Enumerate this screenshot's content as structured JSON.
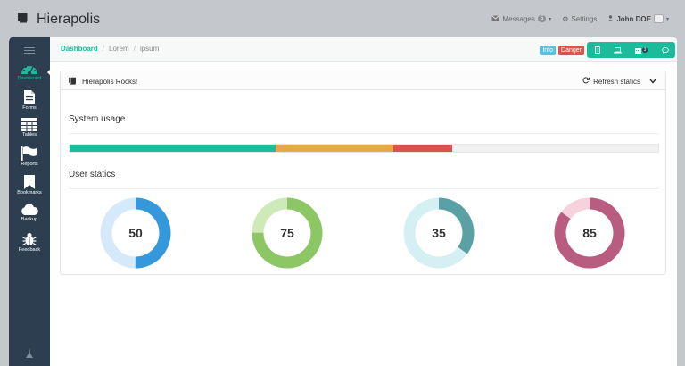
{
  "app": {
    "title": "Hierapolis"
  },
  "topnav": {
    "messages_label": "Messages",
    "messages_count": "5",
    "settings_label": "Settings",
    "user_name": "John DOE"
  },
  "sidebar": {
    "items": [
      {
        "label": "Dashboard",
        "icon": "dashboard-icon",
        "active": true
      },
      {
        "label": "Forms",
        "icon": "document-icon"
      },
      {
        "label": "Tables",
        "icon": "table-icon"
      },
      {
        "label": "Reports",
        "icon": "flag-icon"
      },
      {
        "label": "Bookmarks",
        "icon": "bookmark-icon"
      },
      {
        "label": "Backup",
        "icon": "cloud-icon"
      },
      {
        "label": "Feedback",
        "icon": "bug-icon"
      }
    ]
  },
  "breadcrumb": {
    "items": [
      "Dashboard",
      "Lorem",
      "ipsum"
    ]
  },
  "header_buttons": {
    "info": "Info",
    "danger": "Danger",
    "calendar_count": "3"
  },
  "panel": {
    "title": "Hierapolis Rocks!",
    "refresh_label": "Refresh statics"
  },
  "system_usage": {
    "title": "System usage",
    "segments": [
      {
        "percent": 35,
        "color": "#1abc9c"
      },
      {
        "percent": 20,
        "color": "#e9a847"
      },
      {
        "percent": 10,
        "color": "#d9534f"
      }
    ]
  },
  "user_statics": {
    "title": "User statics",
    "donuts": [
      {
        "value": 50,
        "label": "50",
        "color": "#3498db",
        "track": "#d6e9f8"
      },
      {
        "value": 75,
        "label": "75",
        "color": "#8cc665",
        "track": "#cdeab8"
      },
      {
        "value": 35,
        "label": "35",
        "color": "#5aa0a4",
        "track": "#d4f0f2"
      },
      {
        "value": 85,
        "label": "85",
        "color": "#b85c80",
        "track": "#f6d2dd"
      }
    ]
  },
  "colors": {
    "accent": "#1abc9c",
    "sidebar": "#2c3e50"
  }
}
